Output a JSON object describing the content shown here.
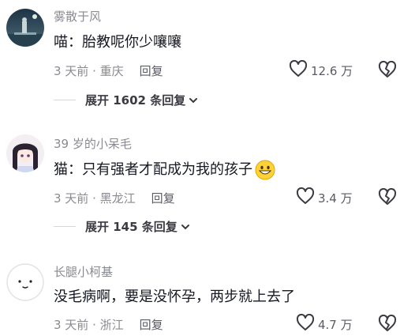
{
  "comments": [
    {
      "username": "雾散于风",
      "text": "喵：胎教呢你少嚷嚷",
      "meta": "3 天前 · 重庆",
      "reply_label": "回复",
      "likes": "12.6 万",
      "expand": "展开 1602 条回复",
      "avatar": "night-scene-photo"
    },
    {
      "username": "39 岁的小呆毛",
      "text": "猫：只有强者才配成为我的孩子",
      "emoji": "grinning-face-emoji",
      "meta": "3 天前 · 黑龙江",
      "reply_label": "回复",
      "likes": "3.4 万",
      "expand": "展开 145 条回复",
      "avatar": "anime-girl"
    },
    {
      "username": "长腿小柯基",
      "text": "没毛病啊，要是没怀孕，两步就上去了",
      "meta": "3 天前 · 浙江",
      "reply_label": "回复",
      "likes": "4.7 万",
      "avatar": "smiley-face"
    }
  ],
  "colors": {
    "primary_text": "#161823",
    "secondary_text": "#8a8b91",
    "divider": "#d6d7db",
    "background": "#ffffff"
  }
}
